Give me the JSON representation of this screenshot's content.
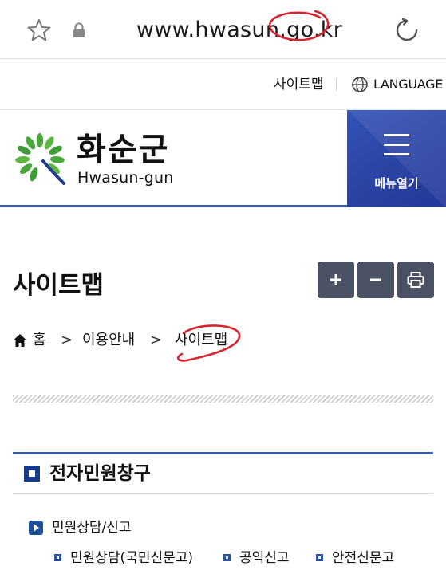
{
  "browser": {
    "url": "www.hwasun.go.kr"
  },
  "utility": {
    "sitemap_label": "사이트맵",
    "language_label": "LANGUAGE"
  },
  "header": {
    "logo_ko": "화순군",
    "logo_en": "Hwasun-gun",
    "menu_label": "메뉴열기"
  },
  "page": {
    "title": "사이트맵",
    "tools": {
      "zoom_in": "+",
      "zoom_out": "−"
    }
  },
  "breadcrumb": {
    "home": "홈",
    "separator": ">",
    "level1": "이용안내",
    "current": "사이트맵"
  },
  "section": {
    "title": "전자민원창구",
    "sub_title": "민원상담/신고",
    "links": [
      "민원상담(국민신문고)",
      "공익신고",
      "안전신문고"
    ]
  },
  "colors": {
    "accent": "#3a5ba8",
    "menu_bg": "#2a43a3",
    "tool_bg": "#4a5263",
    "annotation": "#d9232d"
  }
}
